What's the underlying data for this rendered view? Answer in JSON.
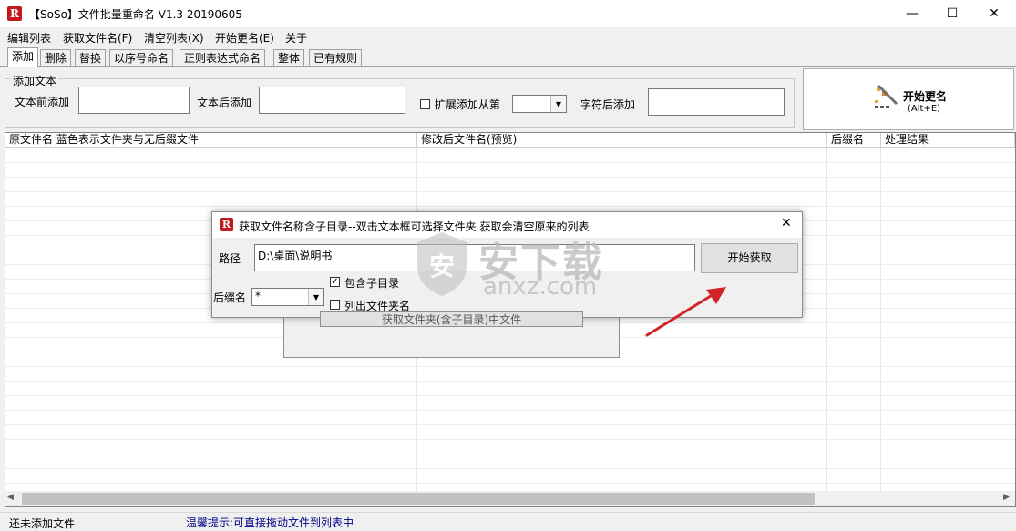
{
  "window": {
    "app_icon_letter": "R",
    "title": "【SoSo】文件批量重命名   V1.3 20190605",
    "minimize_glyph": "—",
    "maximize_glyph": "☐",
    "close_glyph": "✕"
  },
  "menu": {
    "items": [
      "编辑列表",
      "获取文件名(F)",
      "清空列表(X)",
      "开始更名(E)",
      "关于"
    ]
  },
  "tabs": [
    "添加",
    "删除",
    "替换",
    "以序号命名",
    "正则表达式命名",
    "整体",
    "已有规则"
  ],
  "add_text_group": {
    "title": "添加文本",
    "before_label": "文本前添加",
    "after_label": "文本后添加",
    "extend_label": "扩展添加从第",
    "after_char_label": "字符后添加"
  },
  "start_rename_button": {
    "label": "开始更名",
    "shortcut": "(Alt+E)"
  },
  "list": {
    "columns": [
      "原文件名  蓝色表示文件夹与无后缀文件",
      "修改后文件名(预览)",
      "后缀名",
      "处理结果"
    ]
  },
  "status": {
    "left": "还未添加文件",
    "tip": "温馨提示:可直接拖动文件到列表中"
  },
  "dialog": {
    "title": "获取文件名称含子目录--双击文本框可选择文件夹  获取会清空原来的列表",
    "path_label": "路径",
    "path_value": "D:\\桌面\\说明书",
    "fetch_button": "开始获取",
    "suffix_label": "后缀名",
    "suffix_value": "*",
    "include_subdirs": "包含子目录",
    "include_subdirs_checked": true,
    "list_folder_names": "列出文件夹名",
    "list_folder_names_checked": false,
    "hidden_button_text": "获取文件夹(含子目录)中文件"
  },
  "watermark": {
    "cn": "安下载",
    "en": "anxz.com"
  },
  "colors": {
    "status_tip": "#00008b",
    "arrow": "#d22424",
    "app_icon": "#c21a1a"
  }
}
